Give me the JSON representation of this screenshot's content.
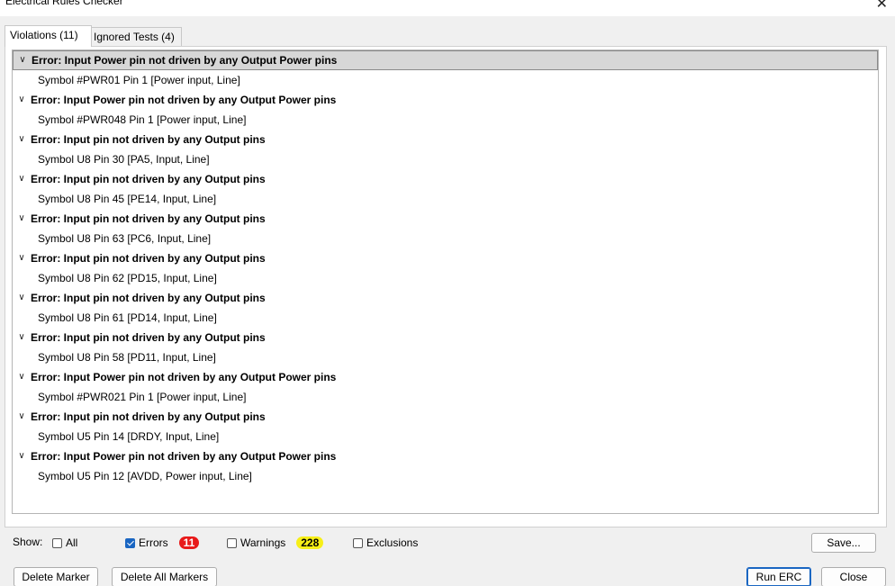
{
  "window": {
    "title": "Electrical Rules Checker"
  },
  "tabs": [
    {
      "label": "Violations (11)"
    },
    {
      "label": "Ignored Tests (4)"
    }
  ],
  "violations": [
    {
      "error": "Error: Input Power pin not driven by any Output Power pins",
      "item": "Symbol #PWR01 Pin 1 [Power input, Line]"
    },
    {
      "error": "Error: Input Power pin not driven by any Output Power pins",
      "item": "Symbol #PWR048 Pin 1 [Power input, Line]"
    },
    {
      "error": "Error: Input pin not driven by any Output pins",
      "item": "Symbol U8 Pin 30 [PA5, Input, Line]"
    },
    {
      "error": "Error: Input pin not driven by any Output pins",
      "item": "Symbol U8 Pin 45 [PE14, Input, Line]"
    },
    {
      "error": "Error: Input pin not driven by any Output pins",
      "item": "Symbol U8 Pin 63 [PC6, Input, Line]"
    },
    {
      "error": "Error: Input pin not driven by any Output pins",
      "item": "Symbol U8 Pin 62 [PD15, Input, Line]"
    },
    {
      "error": "Error: Input pin not driven by any Output pins",
      "item": "Symbol U8 Pin 61 [PD14, Input, Line]"
    },
    {
      "error": "Error: Input pin not driven by any Output pins",
      "item": "Symbol U8 Pin 58 [PD11, Input, Line]"
    },
    {
      "error": "Error: Input Power pin not driven by any Output Power pins",
      "item": "Symbol #PWR021 Pin 1 [Power input, Line]"
    },
    {
      "error": "Error: Input pin not driven by any Output pins",
      "item": "Symbol U5 Pin 14 [DRDY, Input, Line]"
    },
    {
      "error": "Error: Input Power pin not driven by any Output Power pins",
      "item": "Symbol U5 Pin 12 [AVDD, Power input, Line]"
    }
  ],
  "filters": {
    "show_label": "Show:",
    "all": {
      "label": "All",
      "checked": false
    },
    "errors": {
      "label": "Errors",
      "checked": true,
      "count": "11",
      "color": "#e81919"
    },
    "warnings": {
      "label": "Warnings",
      "checked": false,
      "count": "228",
      "color": "#f7ef18"
    },
    "exclusions": {
      "label": "Exclusions",
      "checked": false
    }
  },
  "buttons": {
    "save": "Save...",
    "delete_marker": "Delete Marker",
    "delete_all_markers": "Delete All Markers",
    "run_erc": "Run ERC",
    "close": "Close"
  },
  "icons": {
    "close": "close-icon",
    "expand": "chevron-down-icon"
  }
}
